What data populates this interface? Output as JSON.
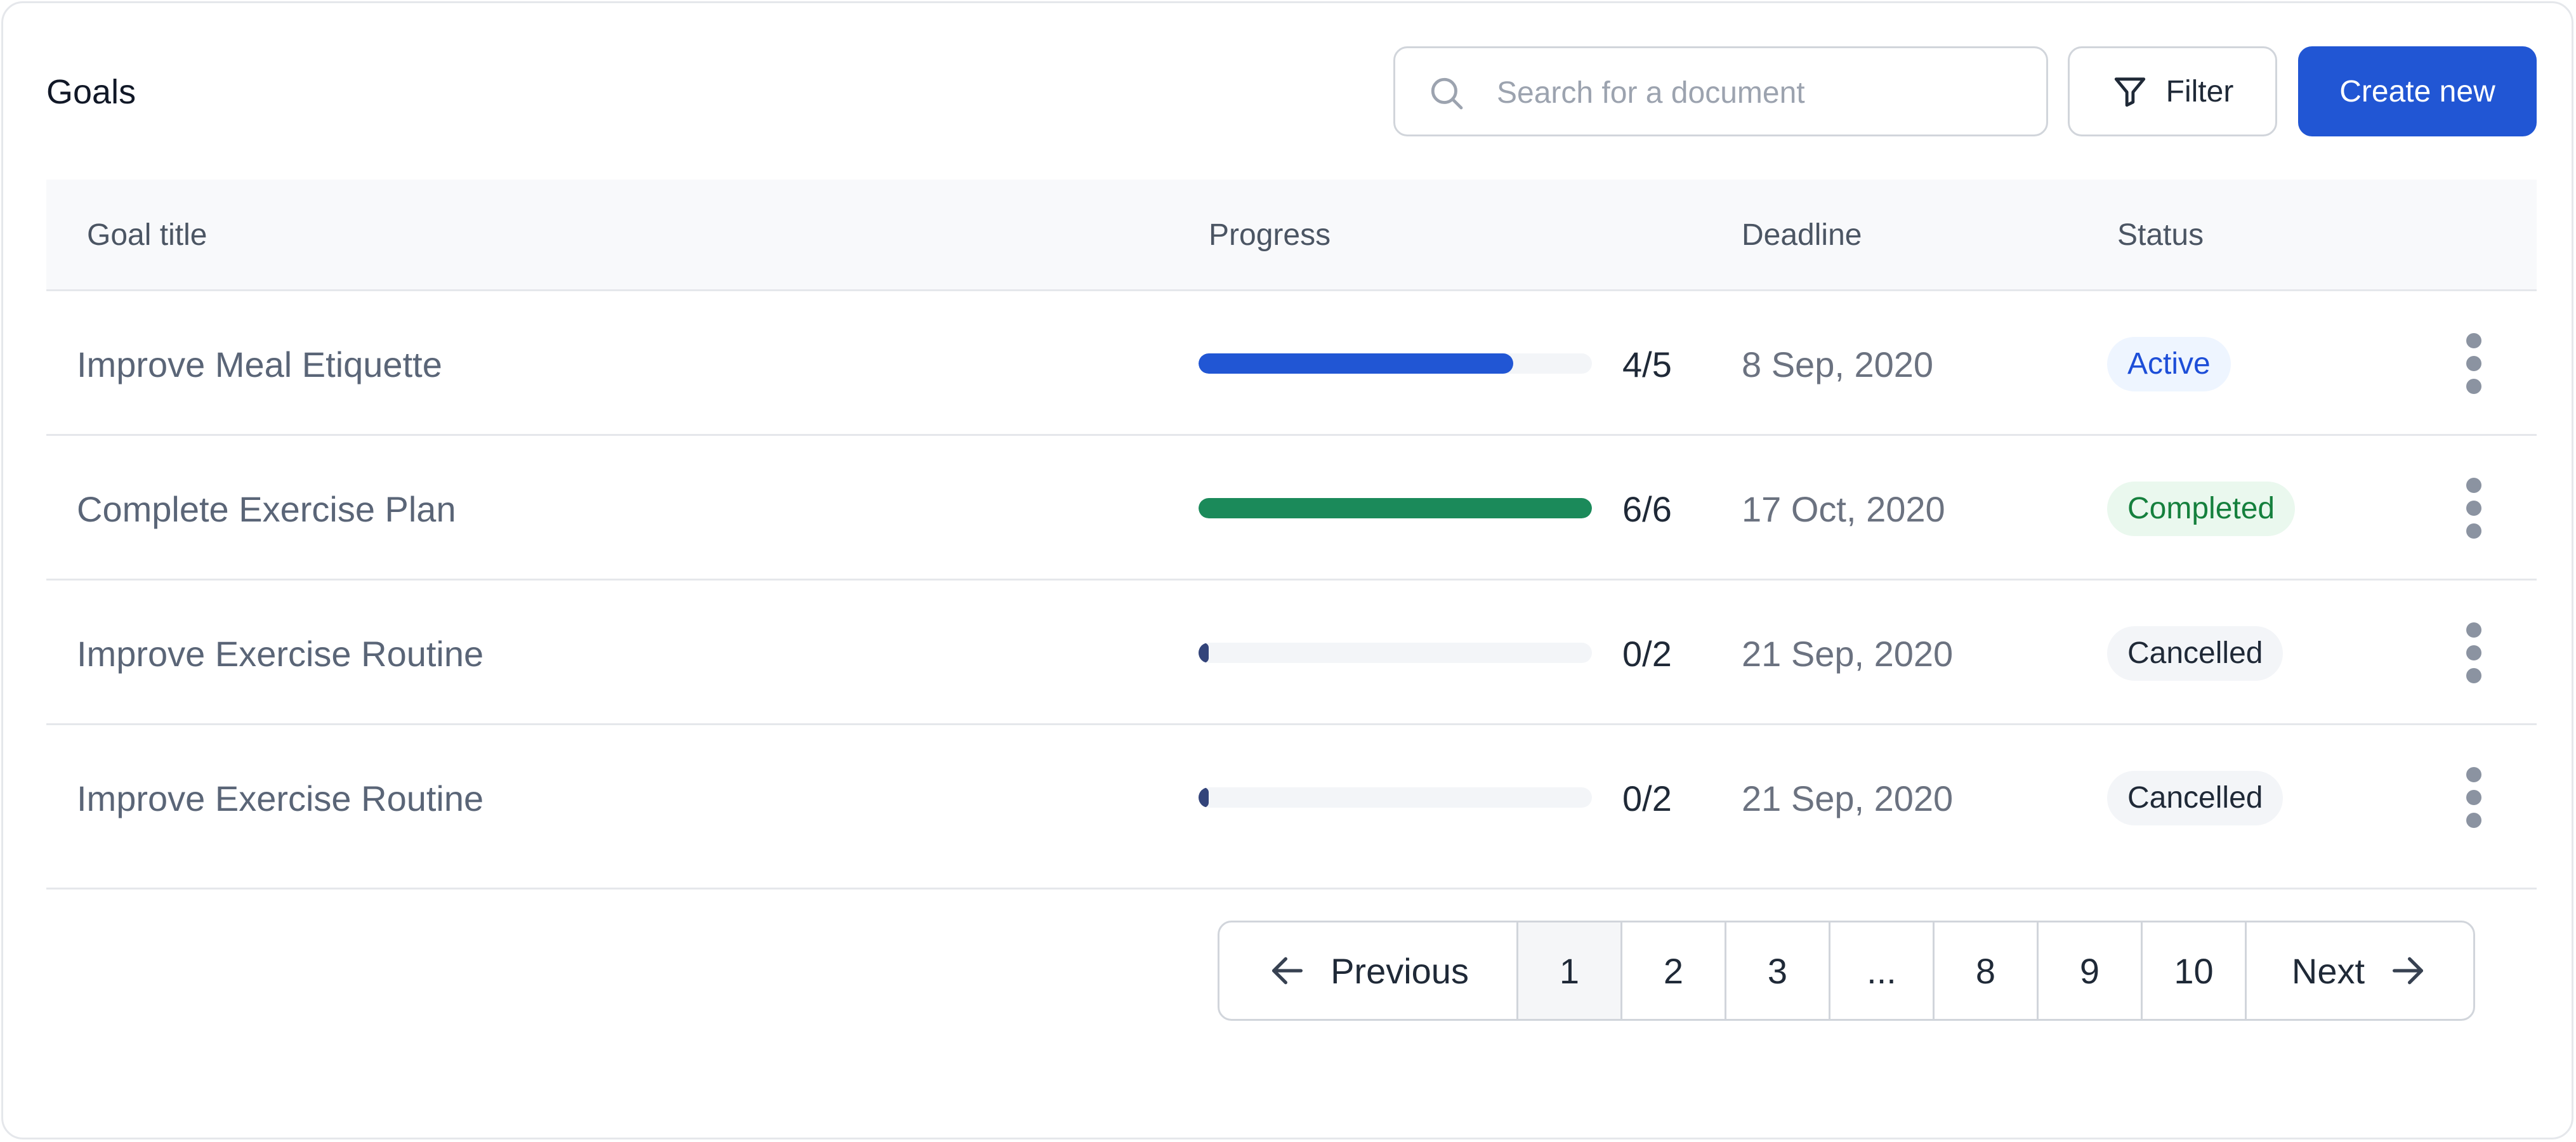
{
  "header": {
    "title": "Goals"
  },
  "search": {
    "placeholder": "Search for a document",
    "value": ""
  },
  "toolbar": {
    "filter_label": "Filter",
    "create_label": "Create new"
  },
  "table": {
    "columns": [
      "Goal  title",
      "Progress",
      "Deadline",
      "Status"
    ],
    "rows": [
      {
        "title": "Improve Meal Etiquette",
        "progress_done": 4,
        "progress_total": 5,
        "progress_label": "4/5",
        "progress_color": "#2156d4",
        "deadline": "8 Sep, 2020",
        "status": "Active",
        "status_kind": "active"
      },
      {
        "title": "Complete Exercise Plan",
        "progress_done": 6,
        "progress_total": 6,
        "progress_label": "6/6",
        "progress_color": "#1b8a5a",
        "deadline": "17 Oct, 2020",
        "status": "Completed",
        "status_kind": "completed"
      },
      {
        "title": "Improve Exercise Routine",
        "progress_done": 0,
        "progress_total": 2,
        "progress_label": "0/2",
        "progress_color": "#33447a",
        "deadline": "21 Sep, 2020",
        "status": "Cancelled",
        "status_kind": "cancelled"
      },
      {
        "title": "Improve Exercise Routine",
        "progress_done": 0,
        "progress_total": 2,
        "progress_label": "0/2",
        "progress_color": "#33447a",
        "deadline": "21 Sep, 2020",
        "status": "Cancelled",
        "status_kind": "cancelled"
      }
    ]
  },
  "pagination": {
    "previous_label": "Previous",
    "next_label": "Next",
    "pages": [
      "1",
      "2",
      "3",
      "...",
      "8",
      "9",
      "10"
    ],
    "current_page": "1"
  },
  "icons": {
    "search": "search-icon",
    "filter": "filter-icon",
    "row_menu": "more-vertical-icon",
    "previous": "arrow-left-icon",
    "next": "arrow-right-icon"
  },
  "colors": {
    "accent": "#2156d4",
    "completed": "#1b8a5a",
    "cancelled": "#33447a"
  }
}
